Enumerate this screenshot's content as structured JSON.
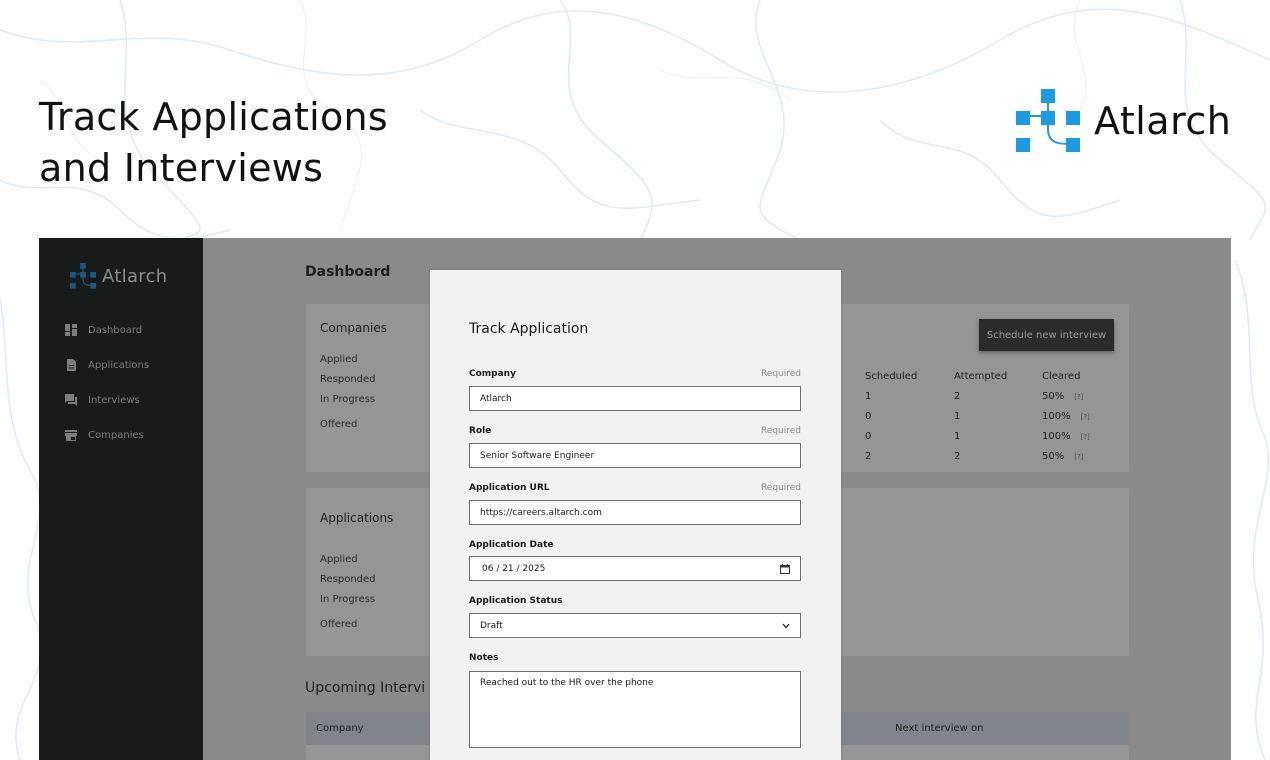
{
  "hero": {
    "title_line1": "Track Applications",
    "title_line2": "and Interviews",
    "brand_name": "Atlarch"
  },
  "colors": {
    "accent": "#1e9be0",
    "sidebar_bg": "#191a1a",
    "overlay": "#8a8a8a",
    "modal_bg": "#f2f2f2"
  },
  "sidebar": {
    "brand_name": "Atlarch",
    "items": [
      {
        "label": "Dashboard",
        "icon": "dashboard-icon"
      },
      {
        "label": "Applications",
        "icon": "document-icon"
      },
      {
        "label": "Interviews",
        "icon": "chat-icon"
      },
      {
        "label": "Companies",
        "icon": "store-icon"
      }
    ]
  },
  "dashboard": {
    "title": "Dashboard",
    "companies_card": {
      "title": "Companies",
      "rows": [
        "Applied",
        "Responded",
        "In Progress",
        "Offered"
      ]
    },
    "interview_stats": {
      "headers": [
        "Scheduled",
        "Attempted",
        "Cleared"
      ],
      "rows": [
        {
          "scheduled": "1",
          "attempted": "2",
          "cleared": "50%",
          "note": "[?]"
        },
        {
          "scheduled": "0",
          "attempted": "1",
          "cleared": "100%",
          "note": "[?]"
        },
        {
          "scheduled": "0",
          "attempted": "1",
          "cleared": "100%",
          "note": "[?]"
        },
        {
          "scheduled": "2",
          "attempted": "2",
          "cleared": "50%",
          "note": "[?]"
        }
      ]
    },
    "schedule_button": "Schedule new interview",
    "applications_card": {
      "title": "Applications",
      "rows": [
        "Applied",
        "Responded",
        "In Progress",
        "Offered"
      ]
    },
    "upcoming": {
      "title": "Upcoming Intervi",
      "col_company": "Company",
      "col_next": "Next interview on"
    }
  },
  "modal": {
    "title": "Track Application",
    "required_text": "Required",
    "company": {
      "label": "Company",
      "value": "Atlarch"
    },
    "role": {
      "label": "Role",
      "value": "Senior Software Engineer"
    },
    "url": {
      "label": "Application URL",
      "value": "https://careers.altarch.com"
    },
    "date": {
      "label": "Application Date",
      "value": "06 / 21 / 2025"
    },
    "status": {
      "label": "Application Status",
      "value": "Draft"
    },
    "notes": {
      "label": "Notes",
      "value": "Reached out to the HR over the phone"
    }
  }
}
